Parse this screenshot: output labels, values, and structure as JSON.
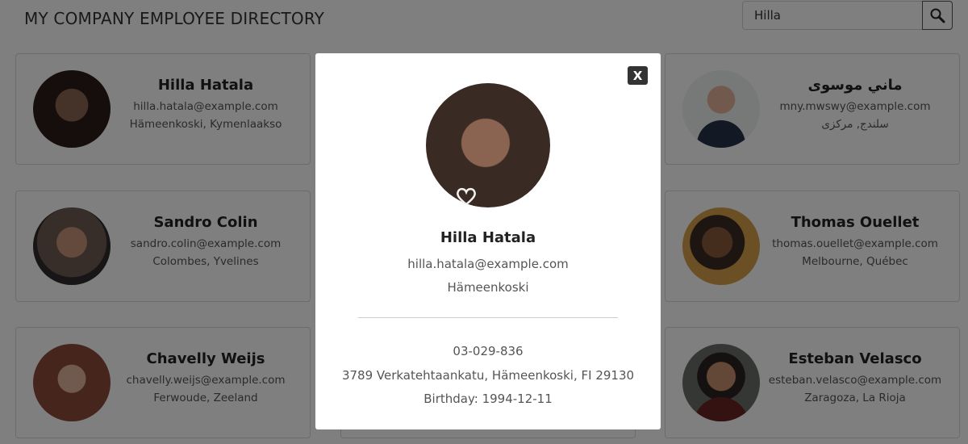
{
  "header": {
    "title": "MY COMPANY EMPLOYEE DIRECTORY",
    "search_value": "Hilla",
    "search_icon": "search-icon"
  },
  "employees": [
    {
      "name": "Hilla Hatala",
      "email": "hilla.hatala@example.com",
      "location": "Hämeenkoski, Kymenlaakso"
    },
    {
      "name": "ماني موسوی",
      "email": "mny.mwswy@example.com",
      "location": "سلندج, مرکزی"
    },
    {
      "name": "Sandro Colin",
      "email": "sandro.colin@example.com",
      "location": "Colombes, Yvelines"
    },
    {
      "name": "Thomas Ouellet",
      "email": "thomas.ouellet@example.com",
      "location": "Melbourne, Québec"
    },
    {
      "name": "Chavelly Weijs",
      "email": "chavelly.weijs@example.com",
      "location": "Ferwoude, Zeeland"
    },
    {
      "name": "Esteban Velasco",
      "email": "esteban.velasco@example.com",
      "location": "Zaragoza, La Rioja"
    }
  ],
  "modal": {
    "close_label": "X",
    "name": "Hilla Hatala",
    "email": "hilla.hatala@example.com",
    "city": "Hämeenkoski",
    "phone": "03-029-836",
    "address": "3789 Verkatehtaankatu, Hämeenkoski, FI 29130",
    "birthday": "Birthday: 1994-12-11"
  },
  "colors": {
    "overlay": "#000000",
    "close_button": "#333333"
  }
}
